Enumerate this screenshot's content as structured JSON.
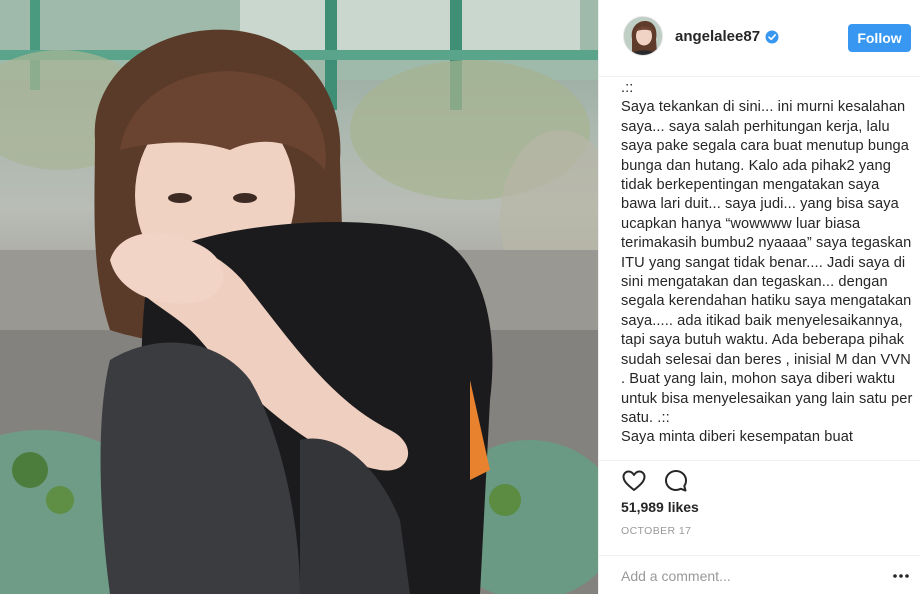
{
  "post": {
    "username": "angelalee87",
    "follow_label": "Follow",
    "caption": ".::\nSaya tekankan di sini... ini murni kesalahan saya... saya salah perhitungan kerja, lalu saya pake segala cara buat menutup bunga bunga dan hutang. Kalo ada pihak2 yang tidak berkepentingan mengatakan saya bawa lari duit... saya judi... yang bisa saya ucapkan hanya “wowwww luar biasa terimakasih bumbu2 nyaaaa” saya tegaskan ITU yang sangat tidak benar.... Jadi saya di sini mengatakan dan tegaskan... dengan segala kerendahan hatiku saya mengatakan saya..... ada itikad baik menyelesaikannya, tapi saya butuh waktu. Ada beberapa pihak sudah selesai dan beres , inisial M dan VVN . Buat yang lain, mohon saya diberi waktu untuk bisa menyelesaikan yang lain satu per satu. .::\nSaya minta diberi kesempatan buat",
    "likes": "51,989 likes",
    "date": "OCTOBER 17",
    "comment_placeholder": "Add a comment..."
  },
  "icons": {
    "avatar": "profile-avatar",
    "verified": "verified-badge-icon",
    "like": "heart-icon",
    "comment": "comment-bubble-icon",
    "more": "more-options-icon"
  },
  "colors": {
    "follow_button": "#3897f0",
    "verified_badge": "#3897f0",
    "date_text": "#999999",
    "divider": "#efefef"
  }
}
